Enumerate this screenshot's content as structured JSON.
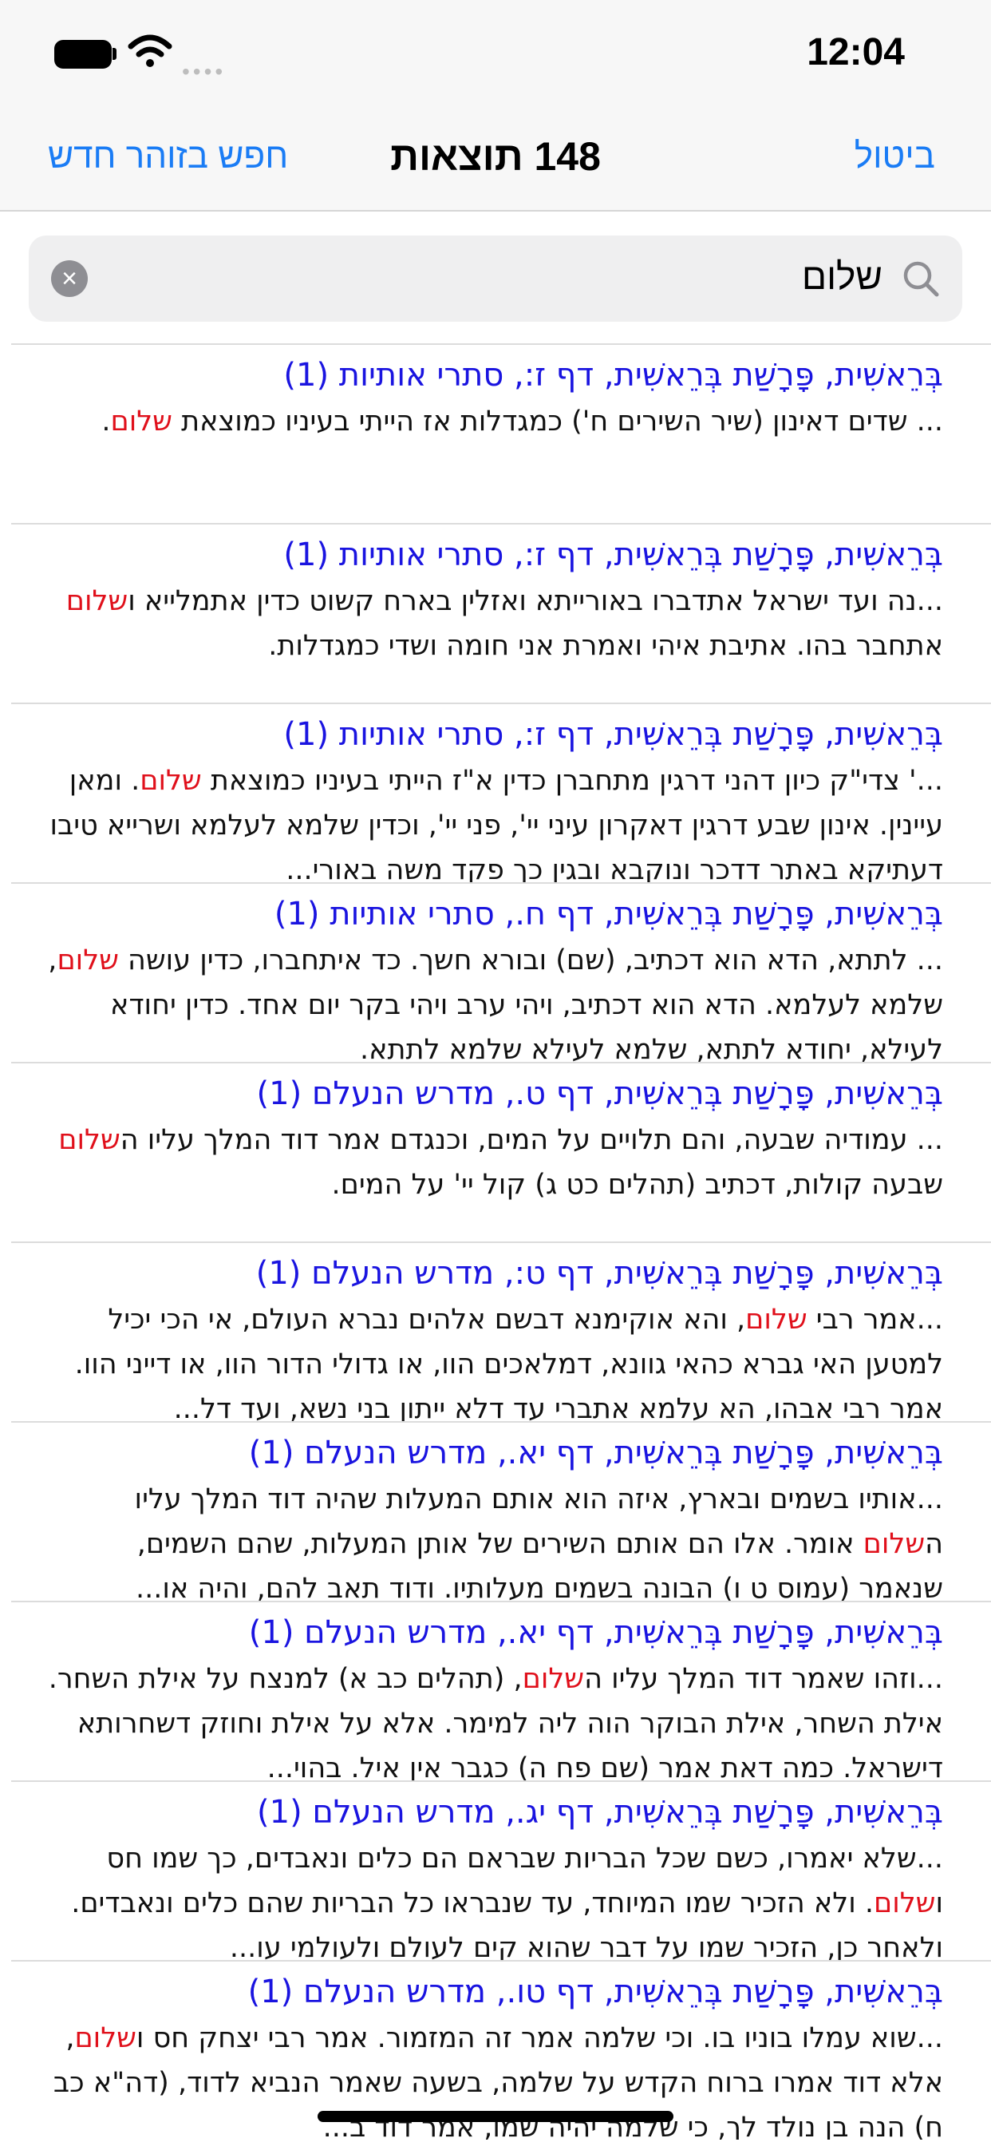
{
  "status_bar": {
    "time": "12:04",
    "icons": [
      "battery-icon",
      "wifi-icon",
      "signal-icon"
    ]
  },
  "nav": {
    "left_label": "חפש בזוהר חדש",
    "title": "148 תוצאות",
    "right_label": "ביטול"
  },
  "search": {
    "query": "שלום",
    "highlight": "שלום"
  },
  "colors": {
    "link": "#1a7cf5",
    "title": "#1a14e0",
    "highlight": "#e0101b"
  },
  "results": [
    {
      "title": "בְּרֵאשִׁית, פָּרָשַׁת בְּרֵאשִׁית, דף ז:, סתרי אותיות (1)",
      "snippet": "... שדים דאינון (שיר השירים ח') כמגדלות אז הייתי בעיניו כמוצאת **שלום**."
    },
    {
      "title": "בְּרֵאשִׁית, פָּרָשַׁת בְּרֵאשִׁית, דף ז:, סתרי אותיות (1)",
      "snippet": "...נה ועד ישראל אתדברו באורייתא ואזלין בארח קשוט כדין אתמלייא ו**שלום** אתחבר בהו. אתיבת איהי ואמרת אני חומה ושדי כמגדלות."
    },
    {
      "title": "בְּרֵאשִׁית, פָּרָשַׁת בְּרֵאשִׁית, דף ז:, סתרי אותיות (1)",
      "snippet": "...' צדי\"ק כיון דהני דרגין מתחברן כדין א\"ז הייתי בעיניו כמוצאת **שלום**. ומאן עיינין. אינון שבע דרגין דאקרון עיני יי', פני יי', וכדין שלמא לעלמא ושרייא טיבו דעתיקא באתר דדכר ונוקבא ובגין כך פקד משה באורי..."
    },
    {
      "title": "בְּרֵאשִׁית, פָּרָשַׁת בְּרֵאשִׁית, דף ח., סתרי אותיות (1)",
      "snippet": "... לתתא, הדא הוא דכתיב, (שם) ובורא חשך. כד איתחברו, כדין עושה **שלום**, שלמא לעלמא. הדא הוא דכתיב, ויהי ערב ויהי בקר יום אחד. כדין יחודא לעילא, יחודא לתתא, שלמא לעילא שלמא לתתא."
    },
    {
      "title": "בְּרֵאשִׁית, פָּרָשַׁת בְּרֵאשִׁית, דף ט., מדרש הנעלם (1)",
      "snippet": "... עמודיה שבעה, והם תלויים על המים, וכנגדם אמר דוד המלך עליו ה**שלום** שבעה קולות, דכתיב (תהלים כט ג) קול יי' על המים."
    },
    {
      "title": "בְּרֵאשִׁית, פָּרָשַׁת בְּרֵאשִׁית, דף ט:, מדרש הנעלם (1)",
      "snippet": "...אמר רבי **שלום**, והא אוקימנא דבשם אלהים נברא העולם, אי הכי יכיל למטען האי גברא כהאי גוונא, דמלאכים הוו, או גדולי הדור הוו, או דייני הוו. אמר רבי אבהו, הא עלמא אתברי עד דלא ייתון בני נשא, ועד דל..."
    },
    {
      "title": "בְּרֵאשִׁית, פָּרָשַׁת בְּרֵאשִׁית, דף יא., מדרש הנעלם (1)",
      "snippet": "...אותיו בשמים ובארץ, איזה הוא אותם המעלות שהיה דוד המלך עליו ה**שלום** אומר. אלו הם אותם השירים של אותן המעלות, שהם השמים, שנאמר (עמוס ט ו) הבונה בשמים מעלותיו. ודוד תאב להם, והיה או..."
    },
    {
      "title": "בְּרֵאשִׁית, פָּרָשַׁת בְּרֵאשִׁית, דף יא., מדרש הנעלם (1)",
      "snippet": "...וזהו שאמר דוד המלך עליו ה**שלום**, (תהלים כב א) למנצח על אילת השחר. אילת השחר, אילת הבוקר הוה ליה למימר. אלא על אילת וחוזק דשחרותא דישראל. כמה דאת אמר (שם פח ה) כגבר אין איל. בהוי..."
    },
    {
      "title": "בְּרֵאשִׁית, פָּרָשַׁת בְּרֵאשִׁית, דף יג., מדרש הנעלם (1)",
      "snippet": "...שלא יאמרו, כשם שכל הבריות שבראם הם כלים ונאבדים, כך שמו חס ו**שלום**. ולא הזכיר שמו המיוחד, עד שנבראו כל הבריות שהם כלים ונאבדים. ולאחר כן, הזכיר שמו על דבר שהוא קים לעולם ולעולמי עו..."
    },
    {
      "title": "בְּרֵאשִׁית, פָּרָשַׁת בְּרֵאשִׁית, דף טו., מדרש הנעלם (1)",
      "snippet": "...שוא עמלו בוניו בו. וכי שלמה אמר זה המזמור. אמר רבי יצחק חס ו**שלום**, אלא דוד אמרו ברוח הקדש על שלמה, בשעה שאמר הנביא לדוד, (דה\"א כב ח) הנה בן נולד לך, כי שלמה יהיה שמו, אמר דוד ב..."
    }
  ]
}
